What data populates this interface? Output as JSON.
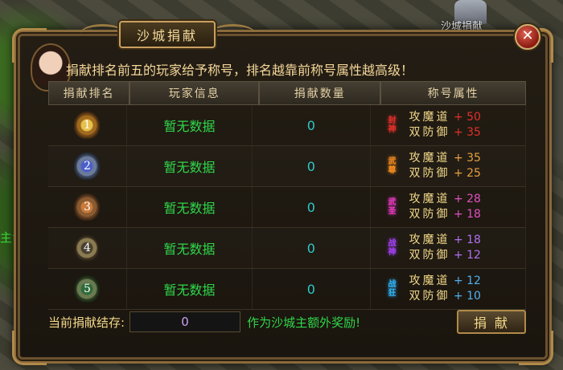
{
  "world": {
    "left_text": "主命之",
    "top_right_text": "沙城捐献"
  },
  "panel": {
    "title": "沙城捐献",
    "close_icon": "close-icon",
    "banner": "捐献排名前五的玩家给予称号，排名越靠前称号属性越高级！"
  },
  "table": {
    "headers": [
      "捐献排名",
      "玩家信息",
      "捐献数量",
      "称号属性"
    ],
    "rows": [
      {
        "rank": "1",
        "medal_icon": "rank-1-medal-icon",
        "player": "暂无数据",
        "amount": "0",
        "title_text": "封神",
        "title_color": "#e0302a",
        "attr1_label": "攻魔道",
        "attr1_value": "+ 50",
        "attr2_label": "双防御",
        "attr2_value": "+ 35",
        "value_color": "#e0302a"
      },
      {
        "rank": "2",
        "medal_icon": "rank-2-medal-icon",
        "player": "暂无数据",
        "amount": "0",
        "title_text": "武尊",
        "title_color": "#f08a20",
        "attr1_label": "攻魔道",
        "attr1_value": "+ 35",
        "attr2_label": "双防御",
        "attr2_value": "+ 25",
        "value_color": "#e8a040"
      },
      {
        "rank": "3",
        "medal_icon": "rank-3-medal-icon",
        "player": "暂无数据",
        "amount": "0",
        "title_text": "武圣",
        "title_color": "#e63ac0",
        "attr1_label": "攻魔道",
        "attr1_value": "+ 28",
        "attr2_label": "双防御",
        "attr2_value": "+ 18",
        "value_color": "#e050c0"
      },
      {
        "rank": "4",
        "medal_icon": "rank-4-medal-icon",
        "player": "暂无数据",
        "amount": "0",
        "title_text": "战神",
        "title_color": "#a040f0",
        "attr1_label": "攻魔道",
        "attr1_value": "+ 18",
        "attr2_label": "双防御",
        "attr2_value": "+ 12",
        "value_color": "#b070f0"
      },
      {
        "rank": "5",
        "medal_icon": "rank-5-medal-icon",
        "player": "暂无数据",
        "amount": "0",
        "title_text": "战狂",
        "title_color": "#30b0f0",
        "attr1_label": "攻魔道",
        "attr1_value": "+ 12",
        "attr2_label": "双防御",
        "attr2_value": "+ 10",
        "value_color": "#50b0f0"
      }
    ]
  },
  "footer": {
    "label": "当前捐献结存:",
    "input_value": "0",
    "note": "作为沙城主额外奖励!",
    "donate_label": "捐献"
  },
  "colors": {
    "gold": "#f3d98a",
    "green": "#2fd74a",
    "cyan": "#2ec9c9"
  }
}
